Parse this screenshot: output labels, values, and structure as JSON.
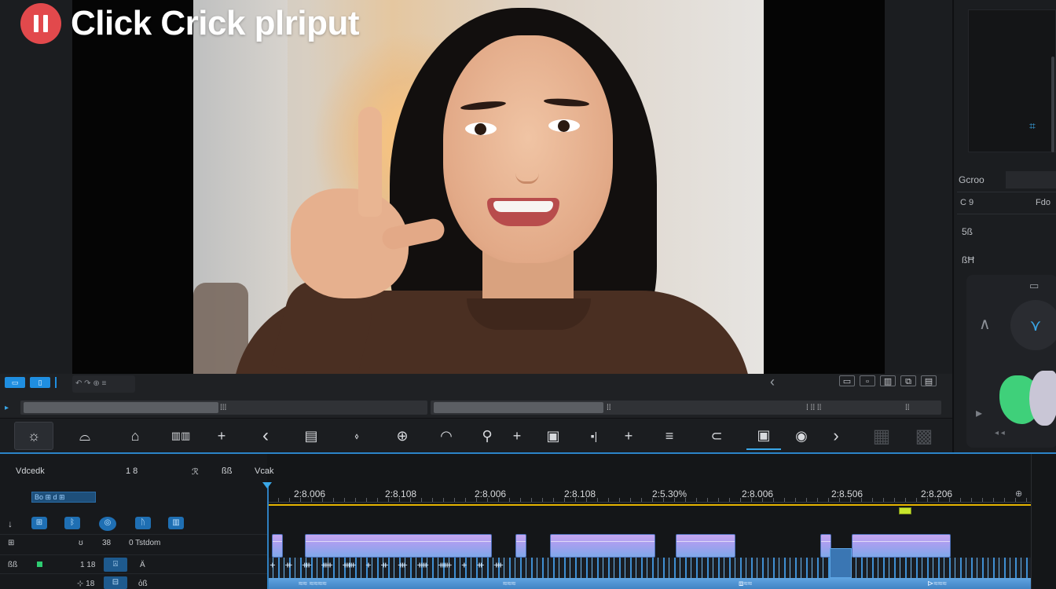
{
  "overlay": {
    "title": "Click Crick plriput",
    "badge_icon": "pause-icon",
    "badge_color": "#e2494c"
  },
  "transport": {
    "btn_a": "▭",
    "btn_b": "▯",
    "mini_controls": "↶ ↷ ⊕ ≡",
    "scrub_label_1": "⁞⁞⁞",
    "scrub_label_2": "⁞⁞",
    "scrub_label_3": "⁞ ⁞⁞ ⁞⁞",
    "scrub_label_4": "⁞⁞",
    "right_icons": [
      "▭",
      "▫",
      "▥",
      "⧉",
      "▤"
    ]
  },
  "toolbar": {
    "tools": [
      "select-tool",
      "trim-tool",
      "razor-tool",
      "slip-tool",
      "add-tool",
      "ripple-tool",
      "text-tool",
      "pen-tool",
      "zoom-tool",
      "crop-tool",
      "link-tool",
      "split-tool",
      "stamp-tool",
      "audio-tool",
      "add-marker-tool",
      "align-tool",
      "transition-tool",
      "caption-tool",
      "record-tool",
      "next-tool",
      "effects-tool",
      "export-tool"
    ],
    "glyphs": [
      "☼",
      "⌓",
      "⌂",
      "▥▥",
      "+",
      "‹",
      "▤",
      "⬫",
      "⊕",
      "◠",
      "⚲",
      "+",
      "▣",
      "▪|",
      "+",
      "≡",
      "⊂",
      "▣",
      "◉",
      "›",
      "▦",
      "▩"
    ]
  },
  "right_panel": {
    "label_1": "Gcroo",
    "label_2": "C 9",
    "label_3": "Fdo",
    "label_4": "5ß",
    "label_5": "ßĦ",
    "crop_icon": "⌗",
    "dial_icon": "⋎",
    "up_icon": "∧",
    "top_icon": "▭",
    "arrow_icon": "▸",
    "small_text": "◂ ◂"
  },
  "timeline": {
    "header_1": "Vdcedk",
    "header_2": "1 8",
    "header_3": "ℛ",
    "header_4": "ßß",
    "header_5": "Vcak",
    "tag": "Bo ⊞ d ⊞",
    "track_icons": [
      "⊞",
      "ᛒ",
      "◎",
      "ᚢ",
      "▥"
    ],
    "row1": {
      "a": "⊞",
      "b": "ʊ",
      "c": "38",
      "d": "0 Tstdom"
    },
    "row2": {
      "a": "ßß",
      "b": "1 18",
      "c": "⍓",
      "d": "Ä"
    },
    "row3": {
      "a": "⊹ 18",
      "b": "⊟",
      "c": "ὀß"
    },
    "ruler_labels": [
      "2:8.006",
      "2:8.108",
      "2:8.006",
      "2:8.108",
      "2:5.30%",
      "2:8.006",
      "2:8.506",
      "2:8.206"
    ],
    "ruler_end": "⊕",
    "wave_glyphs": "ᚐ ᚑ ᚒ ᚓ ᚔ ᚐ ᚑ ᚒ ᚓ ᚔ ᚐ ᚑ ᚒ",
    "audio_labels": [
      "≈≈ ≈≈≈≈",
      "≈≈≈",
      "⧈≈≈",
      "⊳≈≈≈"
    ]
  },
  "colors": {
    "accent": "#3aa7e8",
    "record": "#e2494c",
    "clip": "#a99ff0",
    "workarea": "#e6b400",
    "marker": "#c8e62c"
  }
}
